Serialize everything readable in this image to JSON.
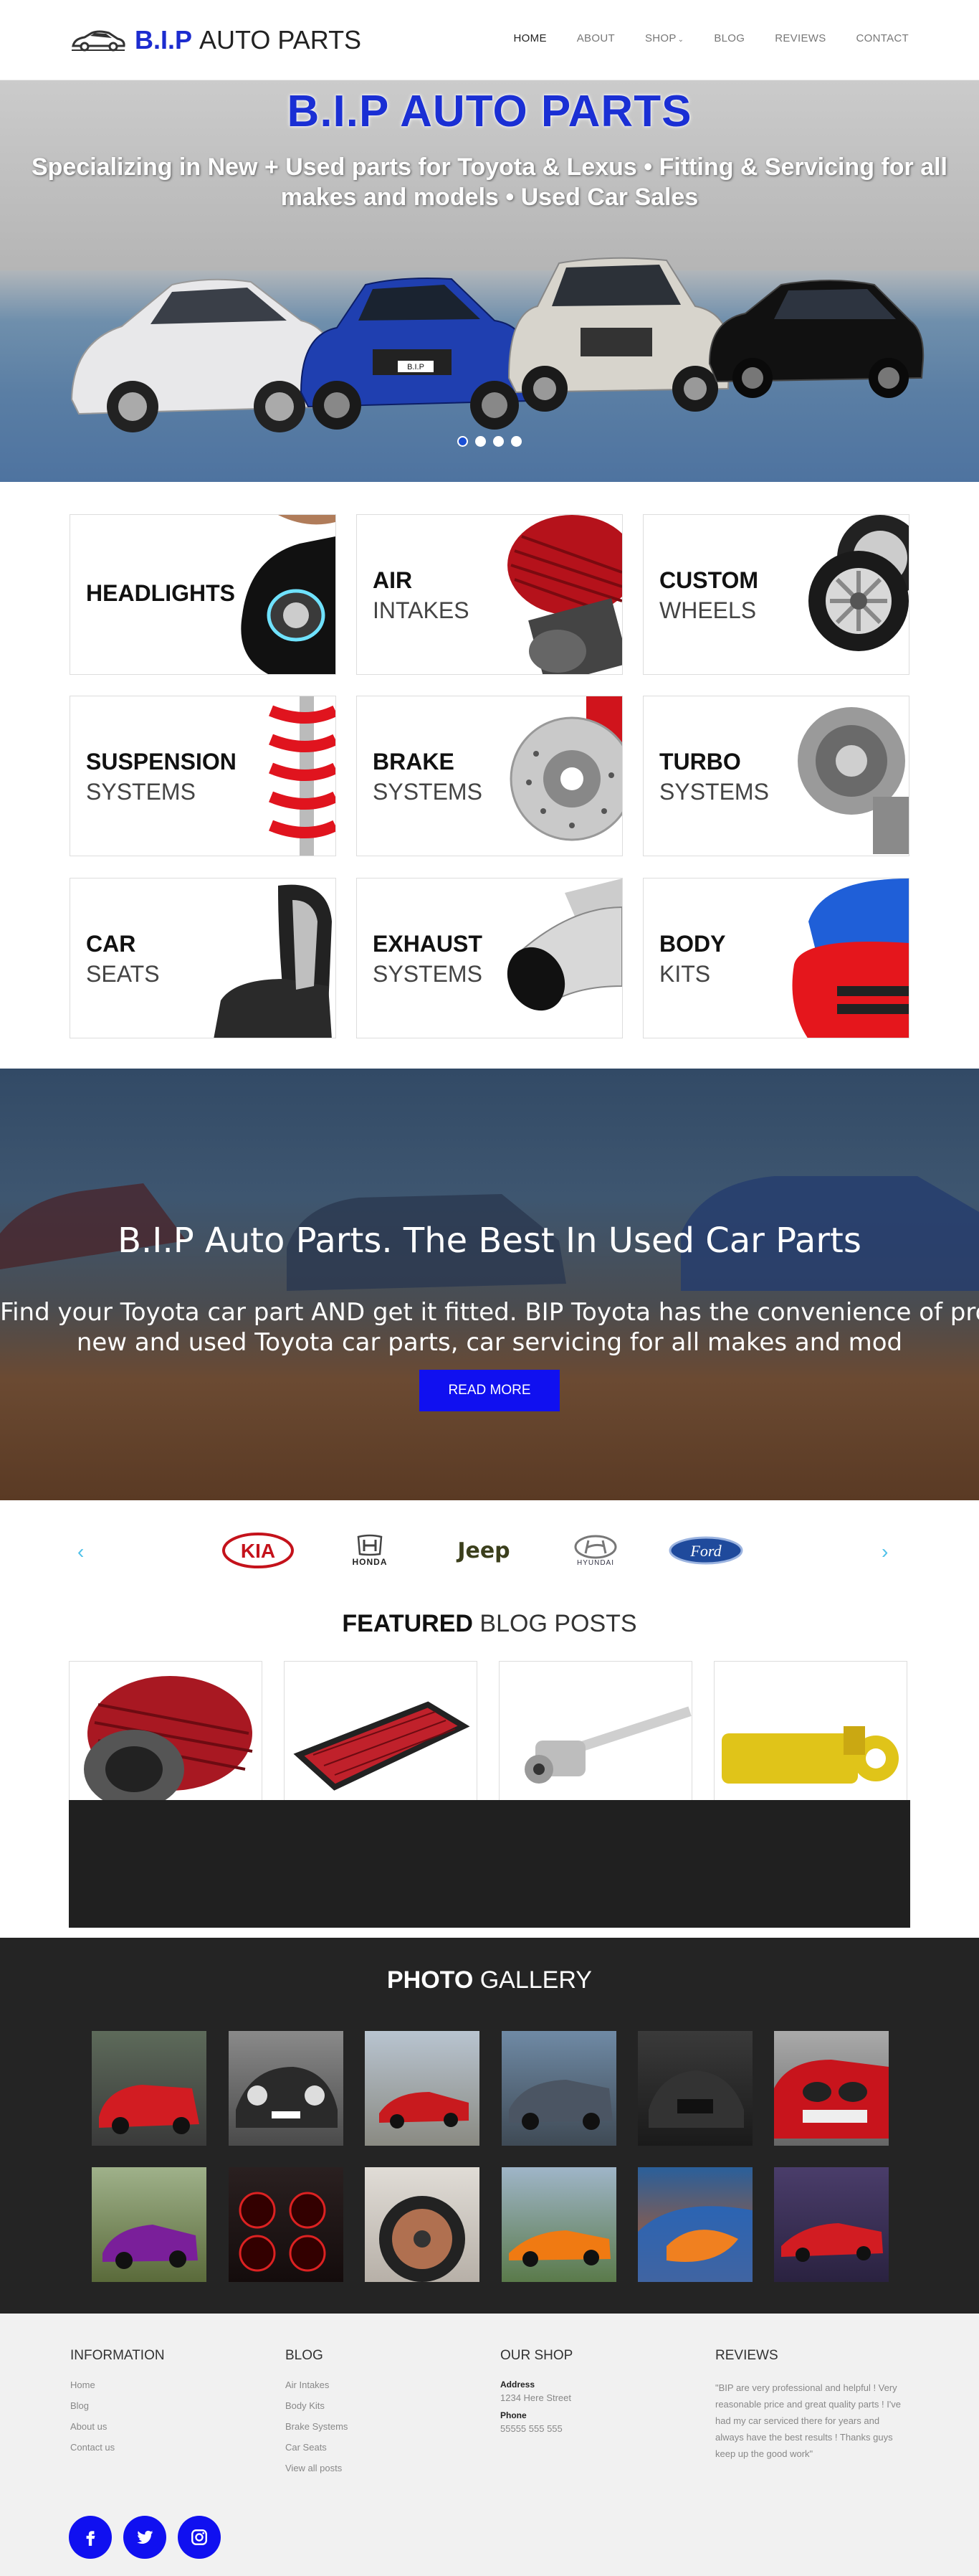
{
  "header": {
    "logo_bip": "B.I.P",
    "logo_rest": "AUTO PARTS",
    "nav": {
      "home": "HOME",
      "about": "ABOUT",
      "shop": "SHOP",
      "blog": "BLOG",
      "reviews": "REVIEWS",
      "contact": "CONTACT"
    }
  },
  "hero": {
    "title": "B.I.P AUTO PARTS",
    "subtitle_line1": "Specializing in New + Used parts for Toyota & Lexus • Fitting & Servicing for all",
    "subtitle_line2": "makes and models • Used Car Sales",
    "plate_text": "B.I.P",
    "slides": 4,
    "active_slide": 1
  },
  "categories": [
    {
      "line1": "HEADLIGHTS",
      "line2": ""
    },
    {
      "line1": "AIR",
      "line2": "INTAKES"
    },
    {
      "line1": "CUSTOM",
      "line2": "WHEELS"
    },
    {
      "line1": "SUSPENSION",
      "line2": "SYSTEMS"
    },
    {
      "line1": "BRAKE",
      "line2": "SYSTEMS"
    },
    {
      "line1": "TURBO",
      "line2": "SYSTEMS"
    },
    {
      "line1": "CAR",
      "line2": "SEATS"
    },
    {
      "line1": "EXHAUST",
      "line2": "SYSTEMS"
    },
    {
      "line1": "BODY",
      "line2": "KITS"
    }
  ],
  "banner": {
    "title": "B.I.P Auto Parts. The Best In Used Car Parts",
    "text_line1": "Find your Toyota car part AND get it fitted. BIP Toyota has the convenience of providing",
    "text_line2": "new and used Toyota car parts, car servicing for all makes and mod",
    "button": "READ MORE"
  },
  "brands": {
    "prev": "‹",
    "next": "›",
    "honda": "HONDA",
    "jeep": "Jeep",
    "hyundai": "HYUNDAI",
    "ford": "Ford"
  },
  "blog": {
    "heading_bold": "FEATURED",
    "heading_rest": "BLOG POSTS"
  },
  "gallery": {
    "heading_bold": "PHOTO",
    "heading_rest": "GALLERY"
  },
  "footer": {
    "information": {
      "title": "INFORMATION",
      "links": [
        "Home",
        "Blog",
        "About us",
        "Contact us"
      ]
    },
    "blog": {
      "title": "BLOG",
      "links": [
        "Air Intakes",
        "Body Kits",
        "Brake Systems",
        "Car Seats",
        "View all posts"
      ]
    },
    "shop": {
      "title": "OUR SHOP",
      "address_label": "Address",
      "address": "1234 Here Street",
      "phone_label": "Phone",
      "phone": "55555 555 555"
    },
    "reviews": {
      "title": "REVIEWS",
      "text": "\"BIP are very professional and helpful ! Very reasonable price and great quality parts ! I've had my car serviced there for years and always have the best results ! Thanks guys keep up the good work\""
    }
  },
  "colors": {
    "brand_blue": "#1c2ccf",
    "button_blue": "#1010f0",
    "arrow_cyan": "#4fc1e9",
    "dark_bg": "#242424"
  }
}
